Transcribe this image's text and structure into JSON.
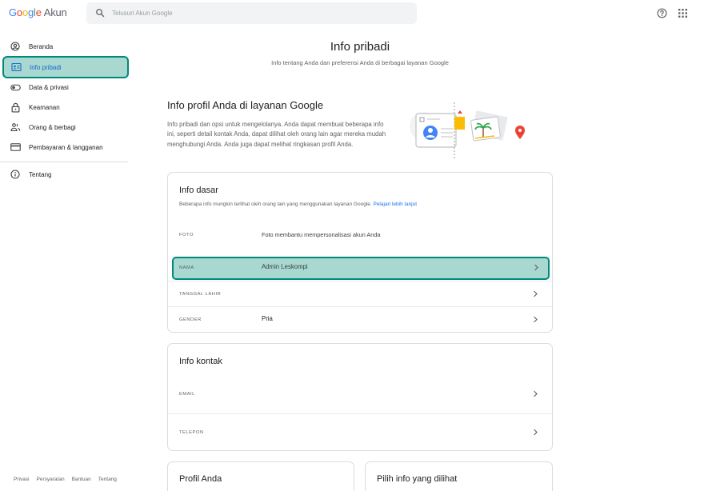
{
  "header": {
    "brand": "Google",
    "brand_suffix": "Akun",
    "search_placeholder": "Telusuri Akun Google"
  },
  "sidebar": {
    "items": [
      {
        "label": "Beranda",
        "icon": "account-circle-icon",
        "active": false
      },
      {
        "label": "Info pribadi",
        "icon": "id-card-icon",
        "active": true
      },
      {
        "label": "Data & privasi",
        "icon": "toggle-icon",
        "active": false
      },
      {
        "label": "Keamanan",
        "icon": "lock-icon",
        "active": false
      },
      {
        "label": "Orang & berbagi",
        "icon": "people-icon",
        "active": false
      },
      {
        "label": "Pembayaran & langganan",
        "icon": "credit-card-icon",
        "active": false
      }
    ],
    "about": {
      "label": "Tentang",
      "icon": "info-icon"
    },
    "footer": [
      "Privasi",
      "Persyaratan",
      "Bantuan",
      "Tentang"
    ]
  },
  "main": {
    "title": "Info pribadi",
    "subtitle": "Info tentang Anda dan preferensi Anda di berbagai layanan Google",
    "profile_section": {
      "title": "Info profil Anda di layanan Google",
      "description": "Info pribadi dan opsi untuk mengelolanya. Anda dapat membuat beberapa info ini, seperti detail kontak Anda, dapat dilihat oleh orang lain agar mereka mudah menghubungi Anda. Anda juga dapat melihat ringkasan profil Anda."
    },
    "basic_info": {
      "title": "Info dasar",
      "description": "Beberapa info mungkin terlihat oleh orang lain yang menggunakan layanan Google.",
      "learn_more": "Pelajari lebih lanjut",
      "rows": [
        {
          "label": "FOTO",
          "value": "Foto membantu mempersonalisasi akun Anda"
        },
        {
          "label": "NAMA",
          "value": "Admin Leskompi"
        },
        {
          "label": "TANGGAL LAHIR",
          "value": ""
        },
        {
          "label": "GENDER",
          "value": "Pria"
        }
      ]
    },
    "contact_info": {
      "title": "Info kontak",
      "rows": [
        {
          "label": "EMAIL",
          "value": ""
        },
        {
          "label": "TELEPON",
          "value": ""
        }
      ]
    },
    "profile_card": {
      "title": "Profil Anda"
    },
    "choose_card": {
      "title": "Pilih info yang dilihat"
    }
  },
  "colors": {
    "highlight_fill": "#a8d8d0",
    "highlight_border": "#00897b",
    "link": "#1a73e8"
  }
}
